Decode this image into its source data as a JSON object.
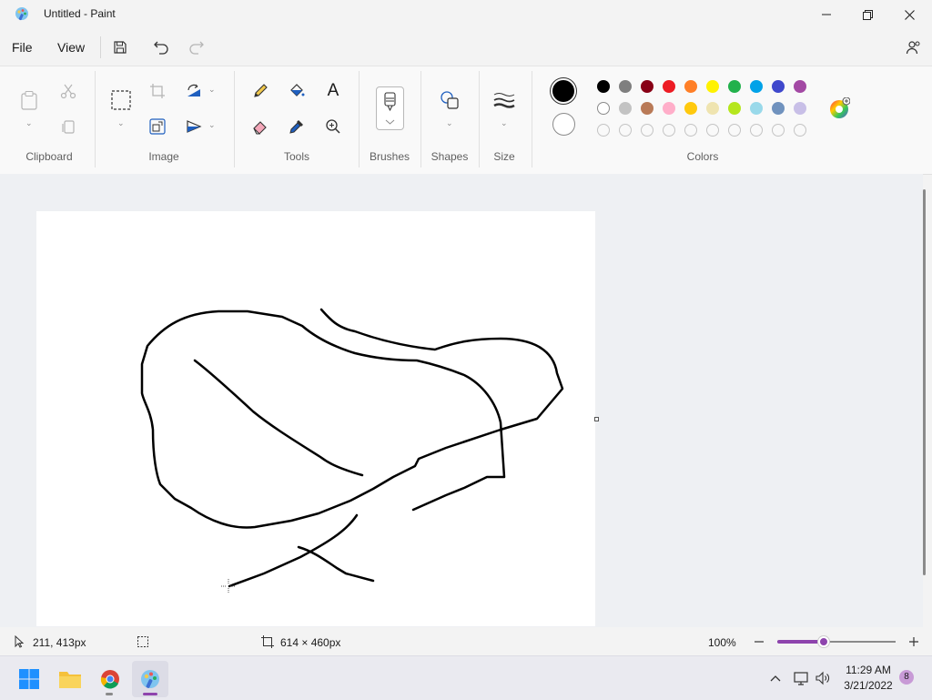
{
  "window": {
    "title": "Untitled - Paint"
  },
  "menu": {
    "file": "File",
    "view": "View"
  },
  "ribbon": {
    "groups": {
      "clipboard": "Clipboard",
      "image": "Image",
      "tools": "Tools",
      "brushes": "Brushes",
      "shapes": "Shapes",
      "size": "Size",
      "colors": "Colors"
    },
    "tools_text_glyph": "A",
    "primary_color": "#000000",
    "secondary_color": "#ffffff",
    "palette_row1": [
      "#000000",
      "#7f7f7f",
      "#880015",
      "#ed1c24",
      "#ff7f27",
      "#fff200",
      "#22b14c",
      "#00a2e8",
      "#3f48cc",
      "#a349a4"
    ],
    "palette_row2": [
      "#ffffff",
      "#c3c3c3",
      "#b97a57",
      "#ffaec9",
      "#ffc90e",
      "#efe4b0",
      "#b5e61d",
      "#99d9ea",
      "#7092be",
      "#c8bfe7"
    ]
  },
  "status": {
    "cursor_position": "211, 413px",
    "canvas_size": "614 × 460px",
    "zoom": "100%",
    "zoom_level": 0.39
  },
  "taskbar": {
    "time": "11:29 AM",
    "date": "3/21/2022",
    "notification_count": "8"
  }
}
